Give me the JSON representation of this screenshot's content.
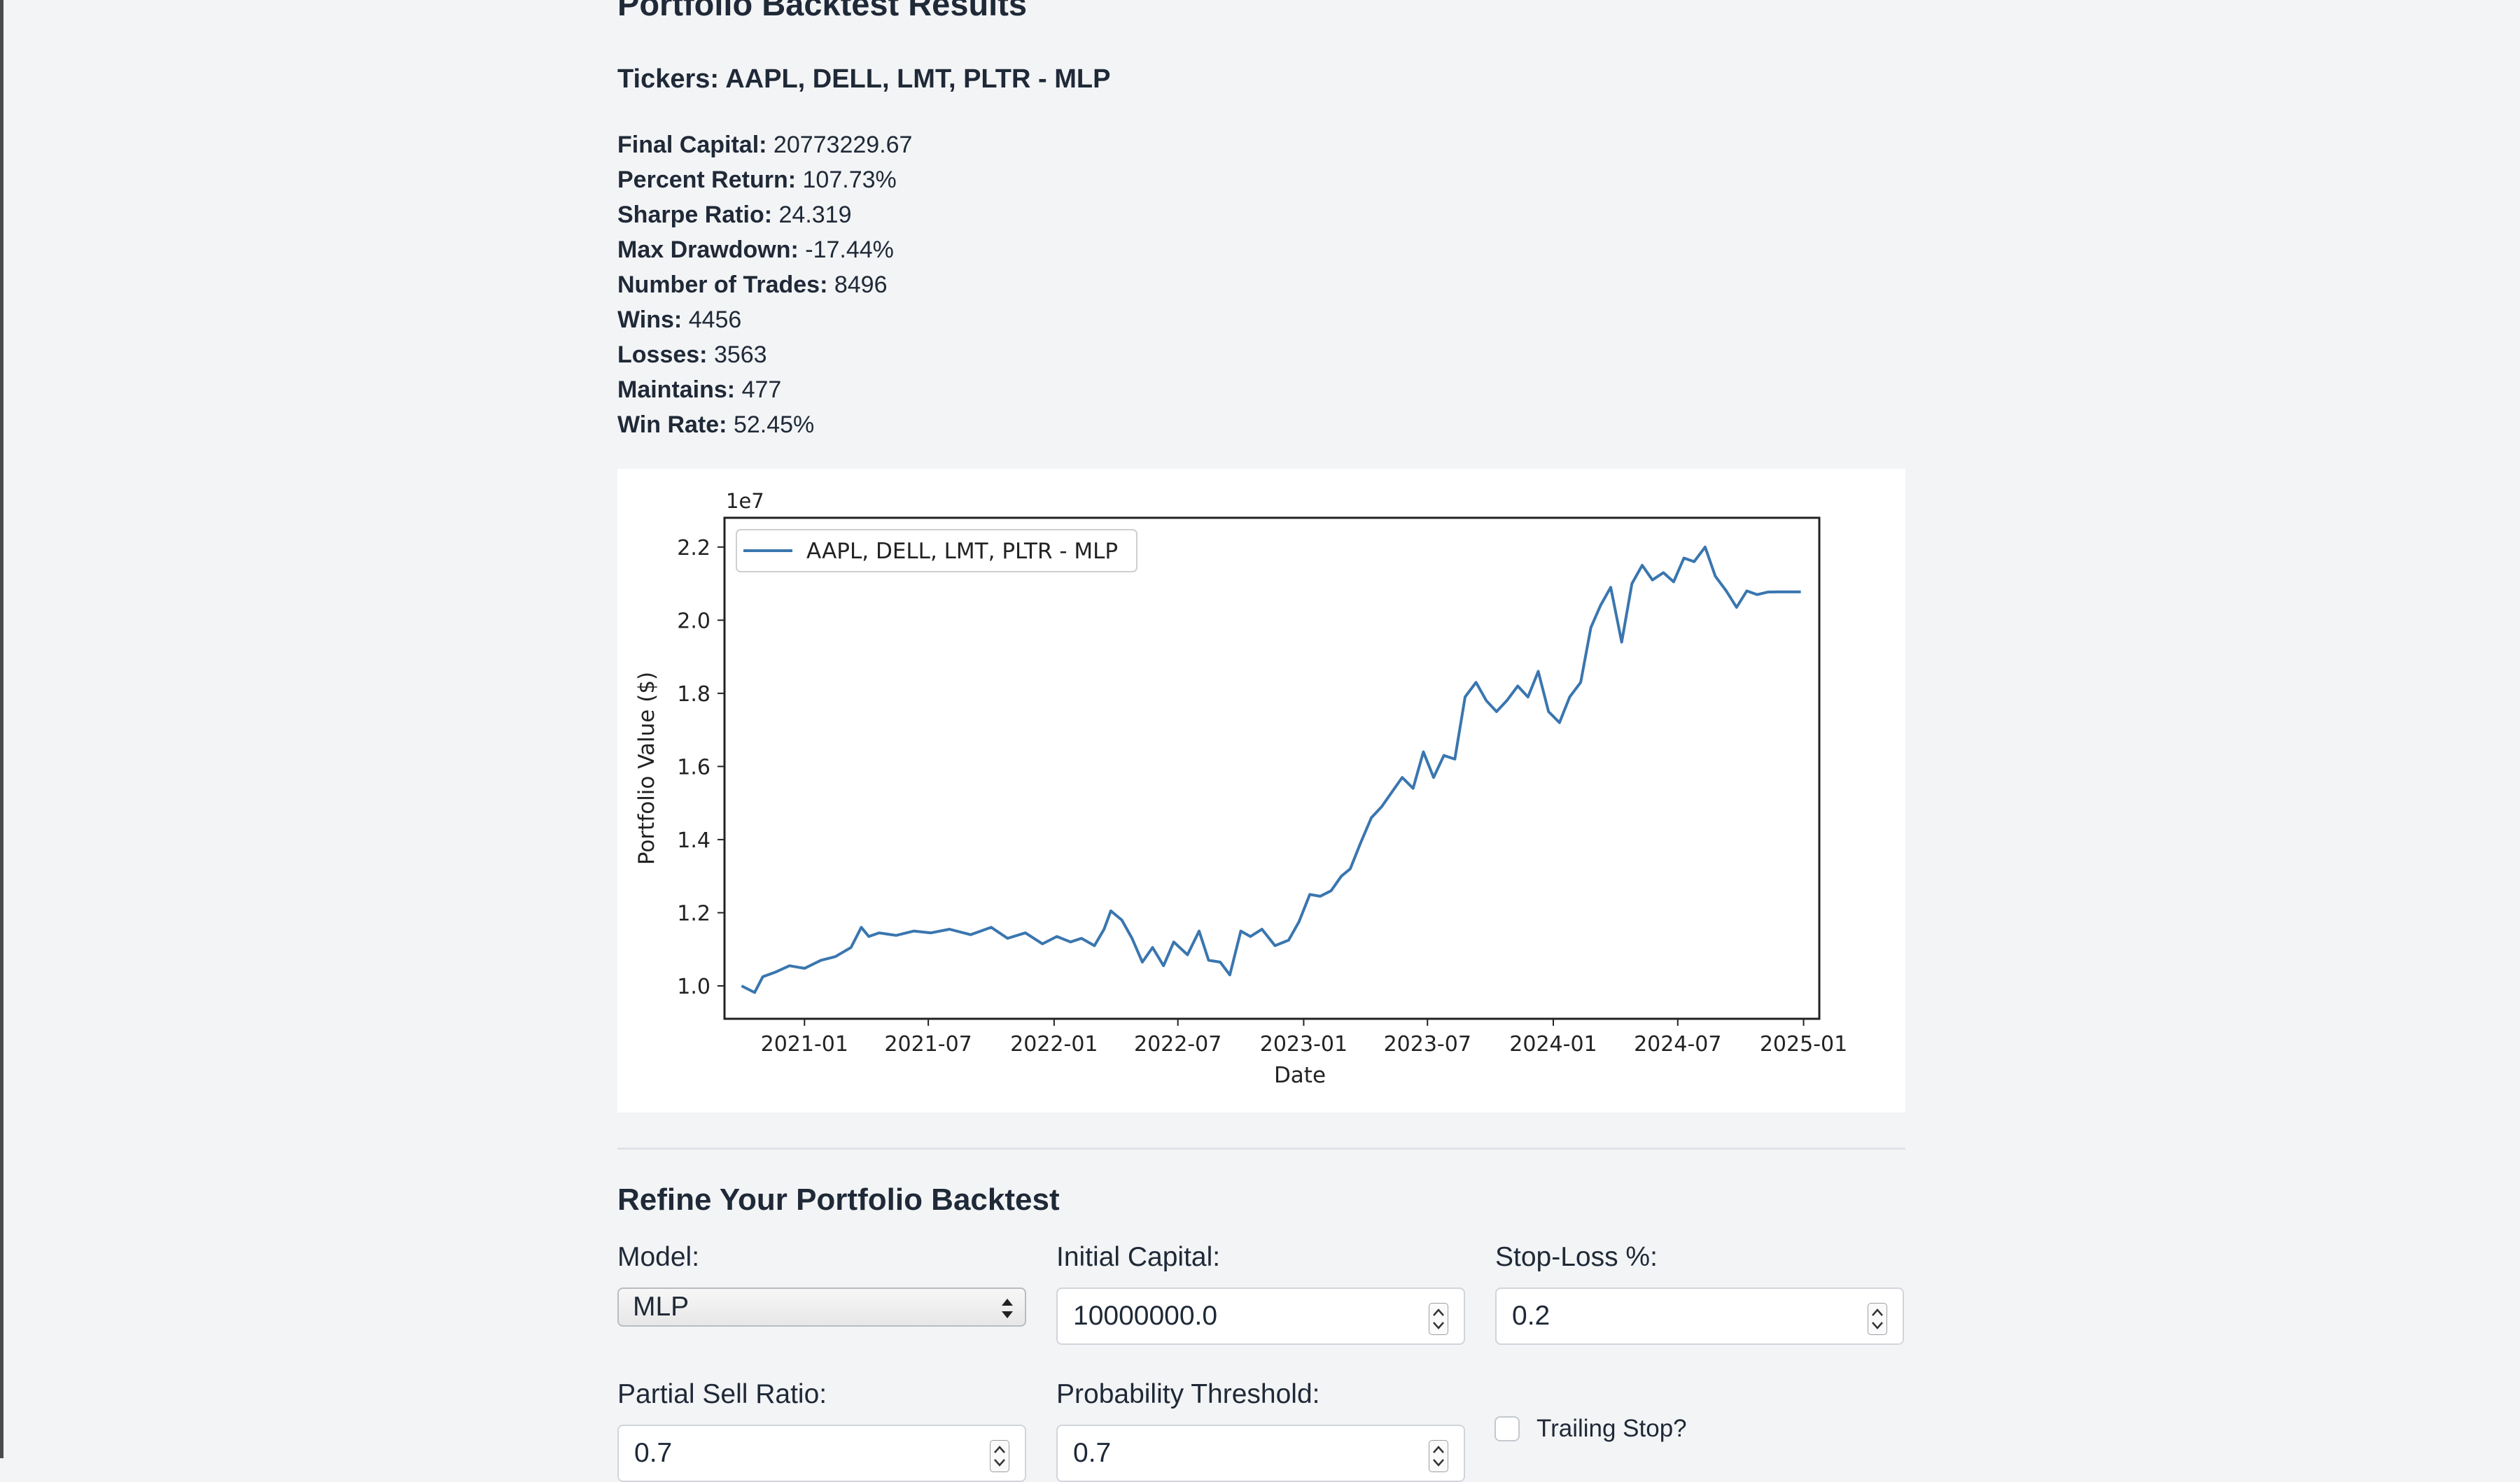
{
  "page": {
    "title": "Portfolio Backtest Results",
    "tickers_heading": "Tickers: AAPL, DELL, LMT, PLTR - MLP"
  },
  "metrics": [
    {
      "label": "Final Capital:",
      "value": "20773229.67"
    },
    {
      "label": "Percent Return:",
      "value": "107.73%"
    },
    {
      "label": "Sharpe Ratio:",
      "value": "24.319"
    },
    {
      "label": "Max Drawdown:",
      "value": "-17.44%"
    },
    {
      "label": "Number of Trades:",
      "value": "8496"
    },
    {
      "label": "Wins:",
      "value": "4456"
    },
    {
      "label": "Losses:",
      "value": "3563"
    },
    {
      "label": "Maintains:",
      "value": "477"
    },
    {
      "label": "Win Rate:",
      "value": "52.45%"
    }
  ],
  "chart_data": {
    "type": "line",
    "xlabel": "Date",
    "ylabel": "Portfolio Value ($)",
    "y_offset_label": "1e7",
    "x_tick_labels": [
      "2021-01",
      "2021-07",
      "2022-01",
      "2022-07",
      "2023-01",
      "2023-07",
      "2024-01",
      "2024-07",
      "2025-01"
    ],
    "y_tick_labels": [
      "1.0",
      "1.2",
      "1.4",
      "1.6",
      "1.8",
      "2.0",
      "2.2"
    ],
    "xlim": [
      "2020-09-06",
      "2025-01-24"
    ],
    "ylim": [
      9100000,
      22800000
    ],
    "legend": "upper left",
    "grid": false,
    "line_color": "#3a76af",
    "series": [
      {
        "name": "AAPL, DELL, LMT, PLTR - MLP",
        "x": [
          "2020-10-01",
          "2020-10-20",
          "2020-11-01",
          "2020-11-20",
          "2020-12-10",
          "2021-01-01",
          "2021-01-25",
          "2021-02-15",
          "2021-03-10",
          "2021-03-25",
          "2021-04-05",
          "2021-04-20",
          "2021-05-15",
          "2021-06-10",
          "2021-07-05",
          "2021-08-01",
          "2021-09-01",
          "2021-10-01",
          "2021-10-25",
          "2021-11-20",
          "2021-12-15",
          "2022-01-05",
          "2022-01-25",
          "2022-02-10",
          "2022-03-01",
          "2022-03-15",
          "2022-03-25",
          "2022-04-10",
          "2022-04-25",
          "2022-05-10",
          "2022-05-25",
          "2022-06-10",
          "2022-06-25",
          "2022-07-15",
          "2022-08-01",
          "2022-08-15",
          "2022-09-01",
          "2022-09-15",
          "2022-10-01",
          "2022-10-15",
          "2022-11-01",
          "2022-11-20",
          "2022-12-10",
          "2022-12-25",
          "2023-01-10",
          "2023-01-25",
          "2023-02-10",
          "2023-02-25",
          "2023-03-10",
          "2023-03-25",
          "2023-04-10",
          "2023-04-25",
          "2023-05-10",
          "2023-05-25",
          "2023-06-10",
          "2023-06-25",
          "2023-07-10",
          "2023-07-25",
          "2023-08-10",
          "2023-08-25",
          "2023-09-10",
          "2023-09-25",
          "2023-10-10",
          "2023-10-25",
          "2023-11-10",
          "2023-11-25",
          "2023-12-10",
          "2023-12-25",
          "2024-01-10",
          "2024-01-25",
          "2024-02-10",
          "2024-02-25",
          "2024-03-10",
          "2024-03-25",
          "2024-04-10",
          "2024-04-25",
          "2024-05-10",
          "2024-05-25",
          "2024-06-10",
          "2024-06-25",
          "2024-07-10",
          "2024-07-25",
          "2024-08-10",
          "2024-08-25",
          "2024-09-10",
          "2024-09-25",
          "2024-10-10",
          "2024-10-25",
          "2024-11-10",
          "2024-11-25",
          "2024-12-05",
          "2024-12-15",
          "2024-12-28"
        ],
        "y": [
          10000000,
          9820000,
          10250000,
          10380000,
          10550000,
          10480000,
          10700000,
          10800000,
          11050000,
          11600000,
          11350000,
          11450000,
          11380000,
          11500000,
          11450000,
          11550000,
          11400000,
          11600000,
          11300000,
          11450000,
          11150000,
          11350000,
          11200000,
          11300000,
          11100000,
          11550000,
          12050000,
          11800000,
          11300000,
          10650000,
          11050000,
          10550000,
          11200000,
          10850000,
          11500000,
          10700000,
          10650000,
          10300000,
          11500000,
          11350000,
          11550000,
          11100000,
          11250000,
          11750000,
          12500000,
          12450000,
          12600000,
          13000000,
          13200000,
          13900000,
          14600000,
          14900000,
          15300000,
          15700000,
          15400000,
          16400000,
          15700000,
          16300000,
          16200000,
          17900000,
          18300000,
          17800000,
          17500000,
          17800000,
          18200000,
          17900000,
          18600000,
          17500000,
          17200000,
          17900000,
          18300000,
          19800000,
          20400000,
          20900000,
          19400000,
          21000000,
          21500000,
          21100000,
          21300000,
          21050000,
          21700000,
          21600000,
          22000000,
          21200000,
          20800000,
          20350000,
          20800000,
          20700000,
          20770000,
          20773229,
          20773229,
          20773229,
          20773229
        ]
      }
    ]
  },
  "form": {
    "heading": "Refine Your Portfolio Backtest",
    "model_label": "Model:",
    "model_value": "MLP",
    "initial_capital_label": "Initial Capital:",
    "initial_capital_value": "10000000.0",
    "stop_loss_label": "Stop-Loss %:",
    "stop_loss_value": "0.2",
    "partial_sell_label": "Partial Sell Ratio:",
    "partial_sell_value": "0.7",
    "probability_label": "Probability Threshold:",
    "probability_value": "0.7",
    "trailing_stop_label": "Trailing Stop?",
    "trailing_stop_checked": false
  }
}
